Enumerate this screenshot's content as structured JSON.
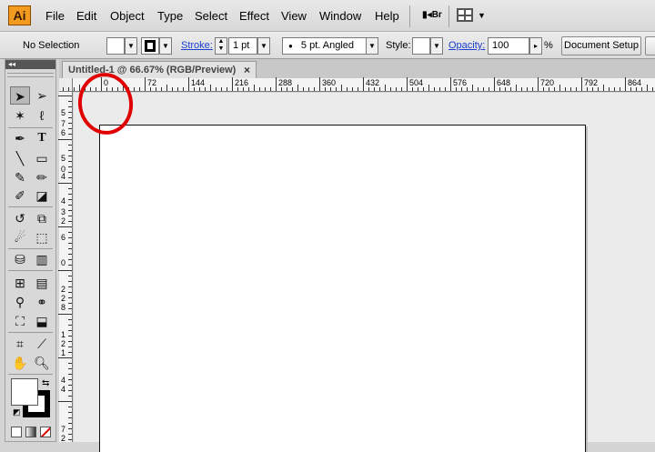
{
  "app": {
    "logo": "Ai",
    "menus": [
      "File",
      "Edit",
      "Object",
      "Type",
      "Select",
      "Effect",
      "View",
      "Window",
      "Help"
    ],
    "bridge_label": "Br"
  },
  "control_bar": {
    "selection_label": "No Selection",
    "stroke_label": "Stroke:",
    "stroke_weight": "1 pt",
    "brush_label": "5 pt. Angled",
    "style_label": "Style:",
    "opacity_label": "Opacity:",
    "opacity_value": "100",
    "opacity_unit": "%",
    "document_setup_label": "Document Setup"
  },
  "document": {
    "tab_title": "Untitled-1 @ 66.67% (RGB/Preview)",
    "close_glyph": "×"
  },
  "rulers": {
    "top_labels": [
      "0",
      "72",
      "144",
      "216",
      "288",
      "360",
      "432",
      "504",
      "576",
      "648",
      "720",
      "792",
      "864"
    ],
    "left_labels": [
      "5",
      "7",
      "6",
      "5",
      "0",
      "4",
      "4",
      "3",
      "2",
      "6",
      "0",
      "2",
      "2",
      "8",
      "1",
      "2",
      "1",
      "4",
      "4",
      "7",
      "2"
    ]
  },
  "toolbar": {
    "collapse_glyph": "◂◂",
    "tools": [
      "selection",
      "direct-selection",
      "magic-wand",
      "lasso",
      "pen",
      "type",
      "line",
      "rectangle",
      "paintbrush",
      "pencil",
      "blob-brush",
      "eraser",
      "rotate",
      "scale",
      "warp",
      "free-transform",
      "symbol-sprayer",
      "column-graph",
      "mesh",
      "gradient",
      "eyedropper",
      "blend",
      "live-paint-bucket",
      "live-paint-selection",
      "artboard",
      "slice",
      "hand",
      "zoom"
    ]
  },
  "annotation": {
    "color": "#e00000"
  },
  "colors": {
    "chrome": "#d4d4d4",
    "canvas": "#ebebeb",
    "artboard": "#ffffff",
    "link": "#1a3fd1"
  }
}
